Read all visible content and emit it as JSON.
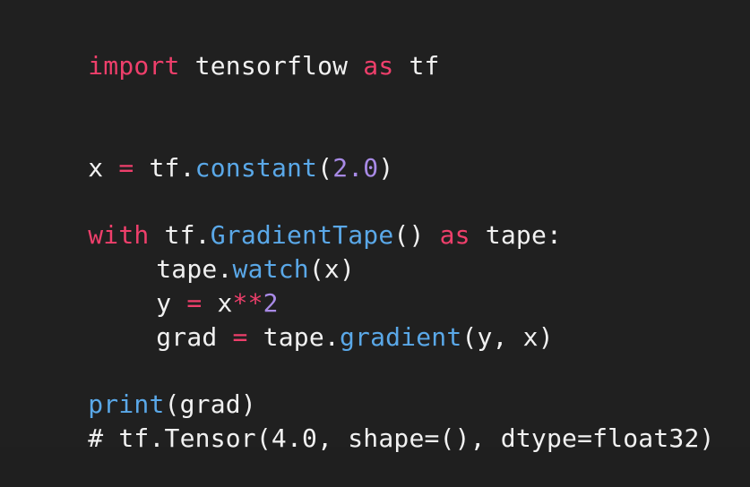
{
  "colors": {
    "background": "#202020",
    "keyword": "#ee3f6b",
    "function": "#5aa8e8",
    "number": "#a88ae6",
    "text": "#f1f1f1"
  },
  "code": {
    "line1": {
      "kw_import": "import",
      "module": " tensorflow ",
      "kw_as": "as",
      "alias": " tf"
    },
    "line2": {
      "var": "x ",
      "eq": "=",
      "obj": " tf.",
      "fn": "constant",
      "open": "(",
      "num": "2.0",
      "close": ")"
    },
    "line3": {
      "kw_with": "with",
      "obj": " tf.",
      "fn": "GradientTape",
      "parens": "() ",
      "kw_as": "as",
      "target": " tape:"
    },
    "line4": {
      "obj": "tape.",
      "fn": "watch",
      "args": "(x)"
    },
    "line5": {
      "var": "y ",
      "eq": "=",
      "base": " x",
      "pow": "**",
      "num": "2"
    },
    "line6": {
      "var": "grad ",
      "eq": "=",
      "obj": " tape.",
      "fn": "gradient",
      "args": "(y, x)"
    },
    "line7": {
      "fn": "print",
      "args": "(grad)"
    },
    "line8": {
      "comment": "# tf.Tensor(4.0, shape=(), dtype=float32)"
    }
  }
}
